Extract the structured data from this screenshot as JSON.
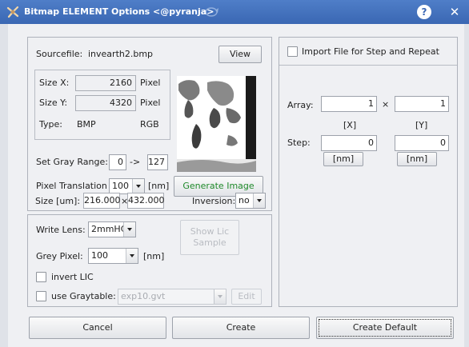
{
  "window": {
    "title": "Bitmap ELEMENT Options <@pyranja>",
    "help_glyph": "?",
    "close_glyph": "✕"
  },
  "source": {
    "label": "Sourcefile:",
    "filename": "invearth2.bmp",
    "view_label": "View",
    "size_x_label": "Size X:",
    "size_x_value": "2160",
    "size_x_unit": "Pixel",
    "size_y_label": "Size Y:",
    "size_y_value": "4320",
    "size_y_unit": "Pixel",
    "type_label": "Type:",
    "type_value": "BMP",
    "mode_value": "RGB",
    "gray_range_label": "Set Gray Range:",
    "gray_min": "0",
    "gray_arrow": "->",
    "gray_max": "127",
    "pixel_translation_label": "Pixel Translation",
    "pixel_translation_value": "100",
    "pixel_translation_unit": "[nm]",
    "generate_label": "Generate Image",
    "size_um_label": "Size [um]:",
    "size_um_x": "216.000",
    "size_um_times": "×",
    "size_um_y": "432.000",
    "inversion_label": "Inversion:",
    "inversion_value": "no"
  },
  "lens": {
    "write_lens_label": "Write Lens:",
    "write_lens_value": "2mmHC",
    "show_lic_line1": "Show Lic",
    "show_lic_line2": "Sample",
    "grey_pixel_label": "Grey Pixel:",
    "grey_pixel_value": "100",
    "grey_pixel_unit": "[nm]",
    "invert_lic_label": "invert LIC",
    "use_graytable_label": "use Graytable:",
    "graytable_value": "exp10.gvt",
    "edit_label": "Edit"
  },
  "repeat": {
    "import_label": "Import File for Step and Repeat",
    "array_label": "Array:",
    "array_x": "1",
    "array_times": "×",
    "array_y": "1",
    "x_label": "[X]",
    "y_label": "[Y]",
    "step_label": "Step:",
    "step_x": "0",
    "step_y": "0",
    "step_x_unit": "[nm]",
    "step_y_unit": "[nm]"
  },
  "footer": {
    "cancel_label": "Cancel",
    "create_label": "Create",
    "create_default_label": "Create Default"
  }
}
